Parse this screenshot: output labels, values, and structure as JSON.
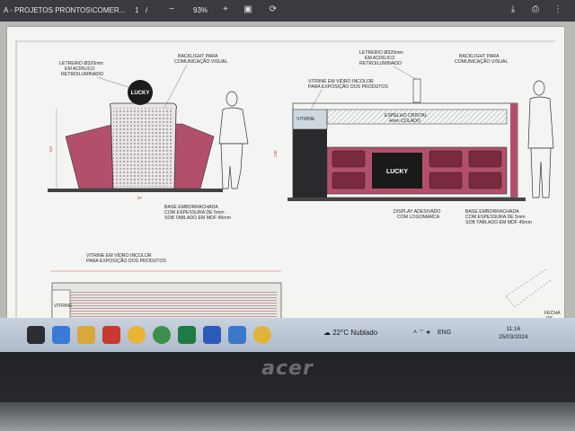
{
  "viewer": {
    "title": "A - PROJETOS PRONTOS\\COMER...",
    "page": "1",
    "page_sep": "/",
    "zoom": "93%"
  },
  "drawing": {
    "left": {
      "sign_label": [
        "LETREIRO Ø320mm",
        "EM ACRILICO",
        "RETROILUMINADO"
      ],
      "backlight_label": [
        "BACKLIGHT PARA",
        "COMUNICAÇÃO VISUAL"
      ],
      "logo_text": "LUCKY",
      "base_label": [
        "BASE EMBORRACHADA",
        "COM ESPESSURA DE 5mm",
        "SOB TABLADO EM MDF 45mm"
      ],
      "height_dim": "115",
      "width_dim": "87"
    },
    "right": {
      "sign_label": [
        "LETREIRO Ø320mm",
        "EM ACRILICO",
        "RETROILUMINADO"
      ],
      "backlight_label": [
        "BACKLIGHT PARA",
        "COMUNICAÇÃO VISUAL"
      ],
      "vitrine_label": [
        "VITRINE EM VIDRO INCOLOR",
        "PARA EXPOSIÇÃO DOS PRODUTOS"
      ],
      "vitrine_text": "VITRINE",
      "mirror_label": [
        "ESPELHO CRISTAL",
        "4mm COLADO"
      ],
      "logo_text": "LUCKY",
      "display_label": [
        "DISPLAY ADESIVADO",
        "COM LOGOMARCA"
      ],
      "base_label": [
        "BASE EMBORRACHADA",
        "COM ESPESSURA DE 5mm",
        "SOB TABLADO EM MDF 45mm"
      ],
      "height_dim": "130"
    },
    "bottom": {
      "vitrine_label": [
        "VITRINE EM VIDRO INCOLOR",
        "PARA EXPOSIÇÃO DOS PRODUTOS"
      ],
      "vitrine_text": "VITRINE",
      "door_label": [
        "FECHA",
        "RK"
      ]
    }
  },
  "taskbar": {
    "weather_temp": "22°C",
    "weather_text": "Nublado",
    "lang": "ENG",
    "time": "11:16",
    "date": "25/03/2024"
  },
  "laptop": {
    "brand": "acer"
  },
  "colors": {
    "counter": "#b2506c",
    "drawer": "#7a2a3e",
    "screen_bg": "#d9d9d5"
  }
}
